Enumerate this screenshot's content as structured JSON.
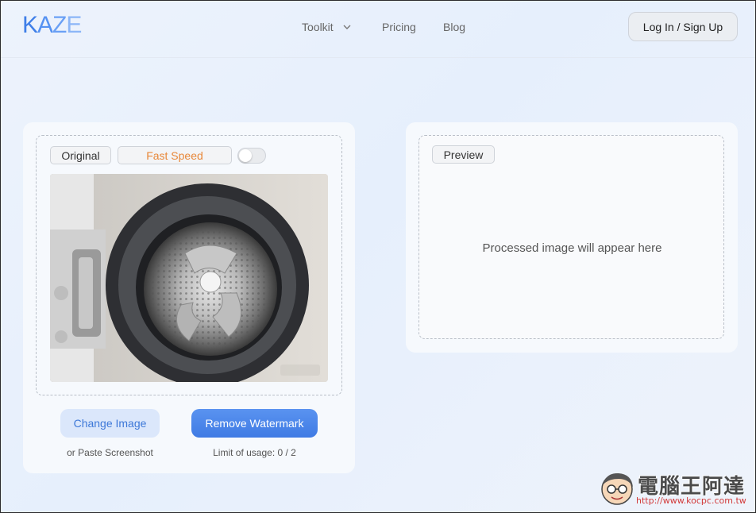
{
  "header": {
    "logo": "KAZE",
    "nav": {
      "toolkit": "Toolkit",
      "pricing": "Pricing",
      "blog": "Blog"
    },
    "login": "Log In / Sign Up"
  },
  "left_panel": {
    "tag_original": "Original",
    "tag_fast": "Fast Speed",
    "toggle_on": false,
    "image_subject": "washing-machine-drum",
    "change_button": "Change Image",
    "remove_button": "Remove Watermark",
    "paste_caption": "or Paste Screenshot",
    "usage_caption": "Limit of usage: 0 / 2"
  },
  "right_panel": {
    "tag_preview": "Preview",
    "placeholder": "Processed image will appear here"
  },
  "watermark": {
    "title": "電腦王阿達",
    "url": "http://www.kocpc.com.tw"
  },
  "colors": {
    "accent": "#4a84ec",
    "fast_speed": "#e8883a",
    "watermark_url": "#d23a3a"
  }
}
